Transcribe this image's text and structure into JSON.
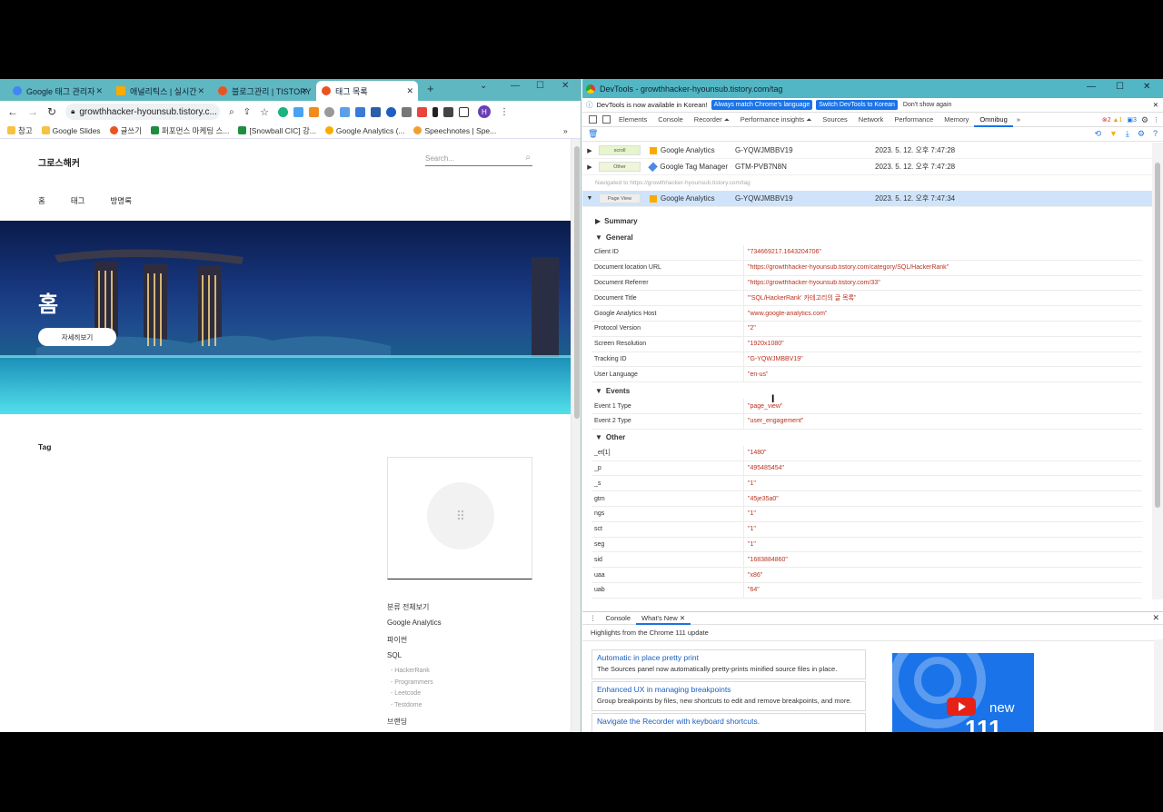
{
  "browser": {
    "tabs": [
      {
        "label": "Google 태그 관리자",
        "color": "#4285f4"
      },
      {
        "label": "애널리틱스 | 실시간",
        "color": "#f9ab00"
      },
      {
        "label": "블로그관리 | TISTORY",
        "color": "#eb531f"
      },
      {
        "label": "태그 목록",
        "color": "#eb531f",
        "active": true
      }
    ],
    "new_tab": "+",
    "url": "growthhacker-hyounsub.tistory.c...",
    "profile_initial": "H",
    "bookmarks": [
      "참고",
      "Google Slides",
      "글쓰기",
      "퍼포먼스 마케팅 스...",
      "[Snowball CIC] 강...",
      "Google Analytics (...",
      "Speechnotes | Spe..."
    ]
  },
  "site": {
    "title": "그로스해커",
    "search_placeholder": "Search...",
    "nav": [
      "홈",
      "태그",
      "방명록"
    ],
    "hero_title": "홈",
    "hero_button": "자세히보기",
    "tag_heading": "Tag",
    "categories": [
      {
        "label": "분류 전체보기"
      },
      {
        "label": "Google Analytics"
      },
      {
        "label": "파이썬"
      },
      {
        "label": "SQL",
        "children": [
          "HackerRank",
          "Programmers",
          "Leetcode",
          "Testdome"
        ]
      },
      {
        "label": "브랜딩"
      }
    ]
  },
  "devtools": {
    "title": "DevTools - growthhacker-hyounsub.tistory.com/tag",
    "info_text": "DevTools is now available in Korean!",
    "info_btn1": "Always match Chrome's language",
    "info_btn2": "Switch DevTools to Korean",
    "info_btn3": "Don't show again",
    "tabs": [
      "Elements",
      "Console",
      "Recorder ⏶",
      "Performance insights ⏶",
      "Sources",
      "Network",
      "Performance",
      "Memory",
      "Omnibug"
    ],
    "selected_tab": "Omnibug",
    "badges": {
      "errors": "2",
      "warnings": "1",
      "messages": "3"
    },
    "hits": [
      {
        "type": "scroll",
        "service": "Google Analytics",
        "account": "G-YQWJMBBV19",
        "time": "2023. 5. 12. 오후 7:47:28"
      },
      {
        "type": "Other",
        "service": "Google Tag Manager",
        "account": "GTM-PVB7N8N",
        "time": "2023. 5. 12. 오후 7:47:28"
      }
    ],
    "navigated": "Navigated to https://growthhacker-hyounsub.tistory.com/tag",
    "open_hit": {
      "type": "Page View",
      "service": "Google Analytics",
      "account": "G-YQWJMBBV19",
      "time": "2023. 5. 12. 오후 7:47:34"
    },
    "sections": {
      "summary": "Summary",
      "general": "General",
      "events": "Events",
      "other": "Other"
    },
    "general": [
      {
        "k": "Client ID",
        "v": "\"734669217.1643204706\""
      },
      {
        "k": "Document location URL",
        "v": "\"https://growthhacker-hyounsub.tistory.com/category/SQL/HackerRank\""
      },
      {
        "k": "Document Referrer",
        "v": "\"https://growthhacker-hyounsub.tistory.com/33\""
      },
      {
        "k": "Document Title",
        "v": "\"'SQL/HackerRank' 카테고리의 글 목록\""
      },
      {
        "k": "Google Analytics Host",
        "v": "\"www.google-analytics.com\""
      },
      {
        "k": "Protocol Version",
        "v": "\"2\""
      },
      {
        "k": "Screen Resolution",
        "v": "\"1920x1080\""
      },
      {
        "k": "Tracking ID",
        "v": "\"G-YQWJMBBV19\""
      },
      {
        "k": "User Language",
        "v": "\"en-us\""
      }
    ],
    "events": [
      {
        "k": "Event 1 Type",
        "v": "\"page_view\""
      },
      {
        "k": "Event 2 Type",
        "v": "\"user_engagement\""
      }
    ],
    "other": [
      {
        "k": "_et[1]",
        "v": "\"1480\""
      },
      {
        "k": "_p",
        "v": "\"495485454\""
      },
      {
        "k": "_s",
        "v": "\"1\""
      },
      {
        "k": "gtm",
        "v": "\"45je35a0\""
      },
      {
        "k": "ngs",
        "v": "\"1\""
      },
      {
        "k": "sct",
        "v": "\"1\""
      },
      {
        "k": "seg",
        "v": "\"1\""
      },
      {
        "k": "sid",
        "v": "\"1683884860\""
      },
      {
        "k": "uaa",
        "v": "\"x86\""
      },
      {
        "k": "uab",
        "v": "\"64\""
      }
    ],
    "drawer_tabs": [
      "Console",
      "What's New"
    ],
    "whats_new_head": "Highlights from the Chrome 111 update",
    "whats_new": [
      {
        "h": "Automatic in place pretty print",
        "d": "The Sources panel now automatically pretty-prints minified source files in place."
      },
      {
        "h": "Enhanced UX in managing breakpoints",
        "d": "Group breakpoints by files, new shortcuts to edit and remove breakpoints, and more."
      },
      {
        "h": "Navigate the Recorder with keyboard shortcuts.",
        "d": ""
      }
    ],
    "video_new": "new",
    "video_num": "111"
  }
}
